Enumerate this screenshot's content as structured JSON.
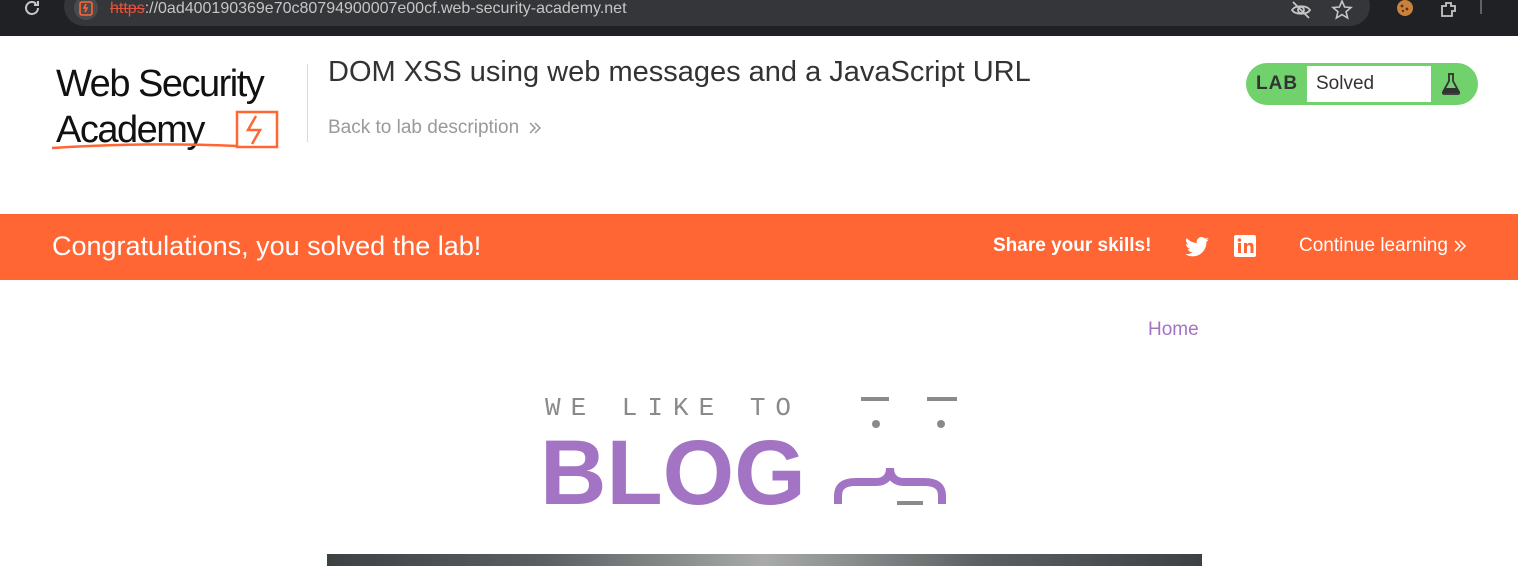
{
  "browser": {
    "url_scheme": "https",
    "url_rest": "://0ad400190369e70c80794900007e00cf.web-security-academy.net",
    "icons": [
      "reload-icon",
      "site-info-icon",
      "eye-off-icon",
      "star-icon",
      "cookie-icon",
      "extensions-icon"
    ]
  },
  "header": {
    "logo_line1": "Web Security",
    "logo_line2": "Academy",
    "title": "DOM XSS using web messages and a JavaScript URL",
    "back_link": "Back to lab description",
    "lab_label": "LAB",
    "lab_status": "Solved"
  },
  "banner": {
    "message": "Congratulations, you solved the lab!",
    "share_label": "Share your skills!",
    "continue_label": "Continue learning"
  },
  "blog": {
    "home_link": "Home",
    "logo_top": "WE LIKE TO",
    "logo_word": "BLOG"
  },
  "colors": {
    "banner": "#ff6633",
    "lab_badge": "#70d16d",
    "blog_purple": "#a474c4",
    "chrome_bg": "#202124"
  }
}
